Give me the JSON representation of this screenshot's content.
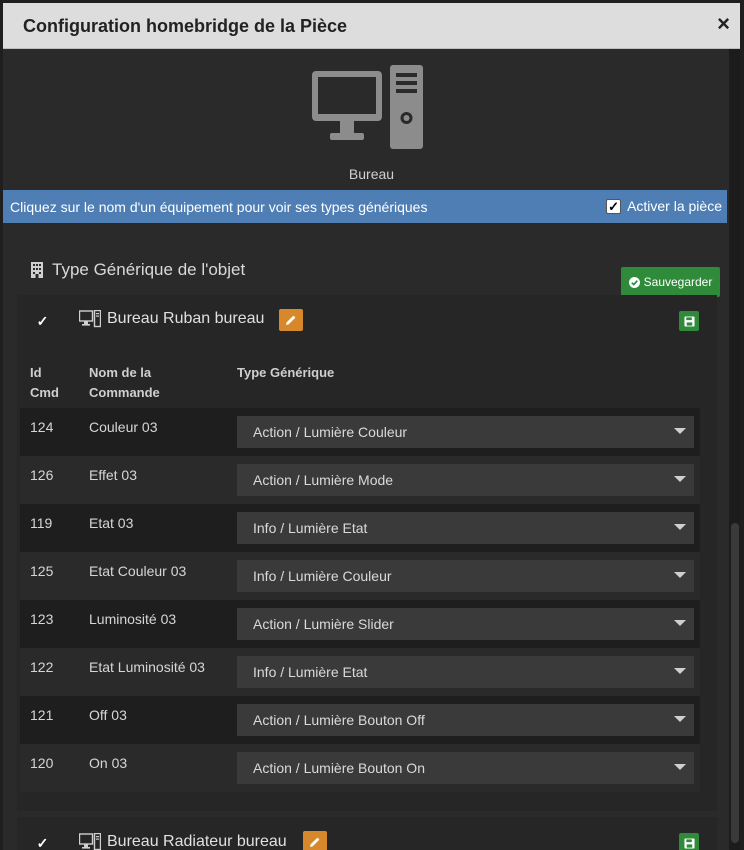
{
  "modal": {
    "title": "Configuration homebridge de la Pièce",
    "close_label": "×"
  },
  "room": {
    "icon": "desktop-computer-icon",
    "name": "Bureau"
  },
  "info_bar": {
    "text": "Cliquez sur le nom d'un équipement pour voir ses types génériques",
    "activate_label": "Activer la pièce",
    "activate_checked": true,
    "color": "#4f7eb5"
  },
  "section": {
    "title": "Type Générique de l'objet",
    "icon": "building-icon",
    "save_label": "Sauvegarder"
  },
  "equipments": [
    {
      "name": "Bureau Ruban bureau",
      "checked": true,
      "icon": "desktop-icon",
      "headers": {
        "id": "Id\nCmd",
        "name": "Nom de la\nCommande",
        "type": "Type Générique"
      },
      "commands": [
        {
          "id": "124",
          "name": "Couleur 03",
          "type": "Action / Lumière Couleur"
        },
        {
          "id": "126",
          "name": "Effet 03",
          "type": "Action / Lumière Mode"
        },
        {
          "id": "119",
          "name": "Etat 03",
          "type": "Info / Lumière Etat"
        },
        {
          "id": "125",
          "name": "Etat Couleur 03",
          "type": "Info / Lumière Couleur"
        },
        {
          "id": "123",
          "name": "Luminosité 03",
          "type": "Action / Lumière Slider"
        },
        {
          "id": "122",
          "name": "Etat Luminosité 03",
          "type": "Info / Lumière Etat"
        },
        {
          "id": "121",
          "name": "Off 03",
          "type": "Action / Lumière Bouton Off"
        },
        {
          "id": "120",
          "name": "On 03",
          "type": "Action / Lumière Bouton On"
        }
      ]
    },
    {
      "name": "Bureau Radiateur bureau",
      "checked": true,
      "icon": "desktop-icon"
    }
  ],
  "colors": {
    "accent_green": "#2f8a3a",
    "edit_orange": "#d6882b"
  }
}
